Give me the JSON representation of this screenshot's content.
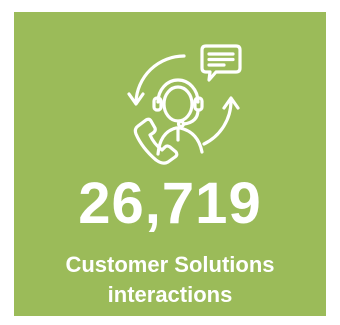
{
  "tile": {
    "background_color": "#9bbb59",
    "text_color": "#ffffff",
    "icon": "customer-support-agent-icon"
  },
  "stat": {
    "value": "26,719",
    "label_line1": "Customer Solutions",
    "label_line2": "interactions"
  }
}
